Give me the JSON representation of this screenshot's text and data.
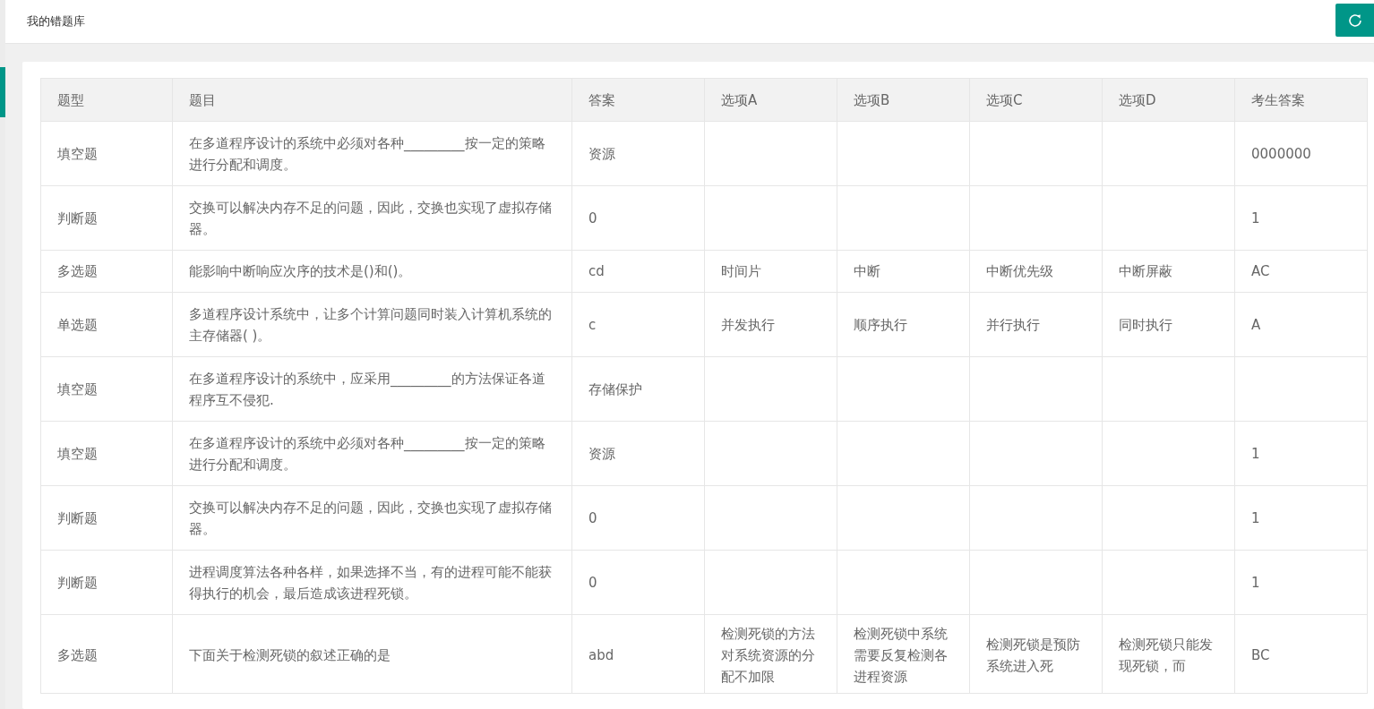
{
  "header": {
    "title": "我的错题库"
  },
  "table": {
    "columns": [
      "题型",
      "题目",
      "答案",
      "选项A",
      "选项B",
      "选项C",
      "选项D",
      "考生答案"
    ],
    "rows": [
      [
        "填空题",
        "在多道程序设计的系统中必须对各种_________按一定的策略进行分配和调度。",
        "资源",
        null,
        null,
        null,
        null,
        "0000000"
      ],
      [
        "判断题",
        "交换可以解决内存不足的问题，因此，交换也实现了虚拟存储器。",
        "0",
        null,
        null,
        null,
        null,
        "1"
      ],
      [
        "多选题",
        "能影响中断响应次序的技术是()和()。",
        "cd",
        "时间片",
        "中断",
        "中断优先级",
        "中断屏蔽",
        "AC"
      ],
      [
        "单选题",
        "多道程序设计系统中，让多个计算问题同时装入计算机系统的主存储器( )。",
        "c",
        "并发执行",
        "顺序执行",
        "并行执行",
        "同时执行",
        "A"
      ],
      [
        "填空题",
        "在多道程序设计的系统中，应采用_________的方法保证各道程序互不侵犯.",
        "存储保护",
        null,
        null,
        null,
        null,
        null
      ],
      [
        "填空题",
        "在多道程序设计的系统中必须对各种_________按一定的策略进行分配和调度。",
        "资源",
        null,
        null,
        null,
        null,
        "1"
      ],
      [
        "判断题",
        "交换可以解决内存不足的问题，因此，交换也实现了虚拟存储器。",
        "0",
        null,
        null,
        null,
        null,
        "1"
      ],
      [
        "判断题",
        "进程调度算法各种各样，如果选择不当，有的进程可能不能获得执行的机会，最后造成该进程死锁。",
        "0",
        null,
        null,
        null,
        null,
        "1"
      ],
      [
        "多选题",
        "下面关于检测死锁的叙述正确的是",
        "abd",
        "检测死锁的方法对系统资源的分配不加限",
        "检测死锁中系统需要反复检测各进程资源",
        "检测死锁是预防系统进入死",
        "检测死锁只能发现死锁，而",
        "BC"
      ]
    ]
  }
}
